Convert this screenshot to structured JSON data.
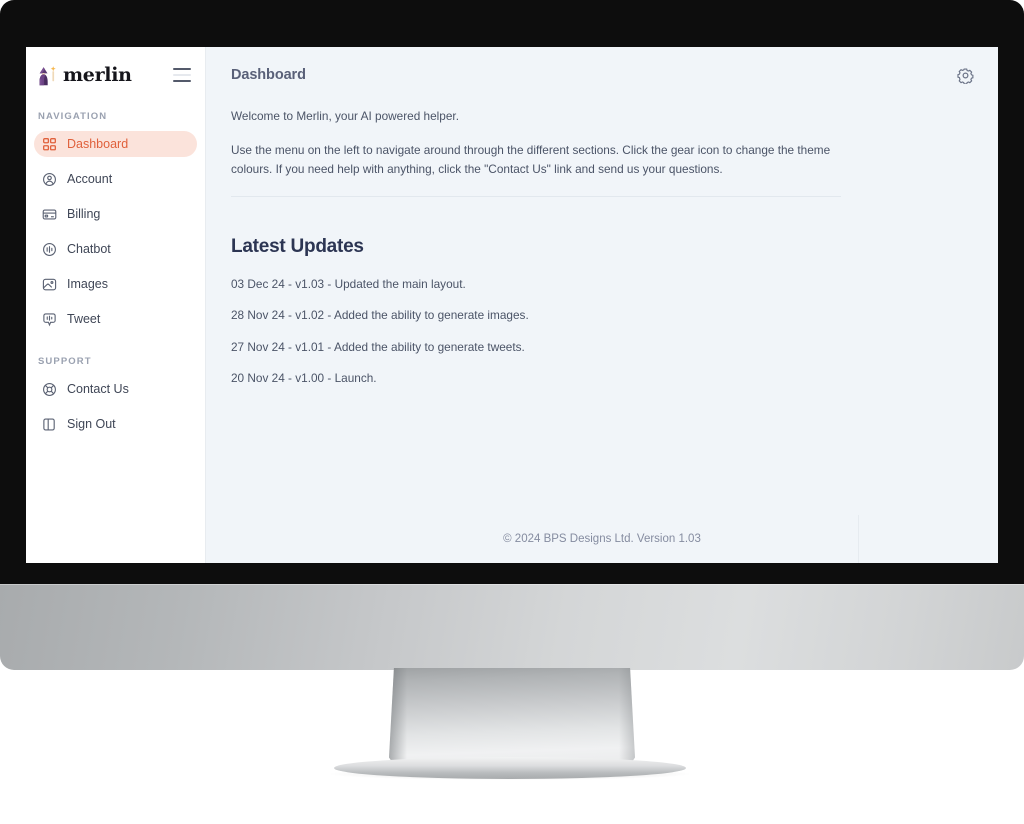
{
  "brand": {
    "name": "merlin",
    "logo_icon": "wizard-icon",
    "menu_icon": "hamburger-menu-icon"
  },
  "sidebar": {
    "sections": [
      {
        "label": "NAVIGATION",
        "items": [
          {
            "label": "Dashboard",
            "icon": "grid-icon",
            "active": true
          },
          {
            "label": "Account",
            "icon": "user-circle-icon",
            "active": false
          },
          {
            "label": "Billing",
            "icon": "credit-card-icon",
            "active": false
          },
          {
            "label": "Chatbot",
            "icon": "chat-circle-icon",
            "active": false
          },
          {
            "label": "Images",
            "icon": "image-icon",
            "active": false
          },
          {
            "label": "Tweet",
            "icon": "speech-bubble-icon",
            "active": false
          }
        ]
      },
      {
        "label": "SUPPORT",
        "items": [
          {
            "label": "Contact Us",
            "icon": "lifebuoy-icon",
            "active": false
          },
          {
            "label": "Sign Out",
            "icon": "sign-out-icon",
            "active": false
          }
        ]
      }
    ]
  },
  "header": {
    "title": "Dashboard",
    "settings_icon": "gear-icon"
  },
  "main": {
    "intro_1": "Welcome to Merlin, your AI powered helper.",
    "intro_2": "Use the menu on the left to navigate around through the different sections. Click the gear icon to change the theme colours. If you need help with anything, click the \"Contact Us\" link and send us your questions.",
    "updates_title": "Latest Updates",
    "updates": [
      "03 Dec 24 - v1.03 - Updated the main layout.",
      "28 Nov 24 - v1.02 - Added the ability to generate images.",
      "27 Nov 24 - v1.01 - Added the ability to generate tweets.",
      "20 Nov 24 - v1.00 - Launch."
    ]
  },
  "footer": {
    "text": "© 2024 BPS Designs Ltd. Version 1.03"
  },
  "colors": {
    "accent": "#e0613c",
    "accent_bg": "#fbe3db",
    "content_bg": "#f1f5f9",
    "sidebar_bg": "#ffffff",
    "heading": "#2c3553",
    "body_text": "#4b5467",
    "bezel": "#0d0d0d"
  }
}
